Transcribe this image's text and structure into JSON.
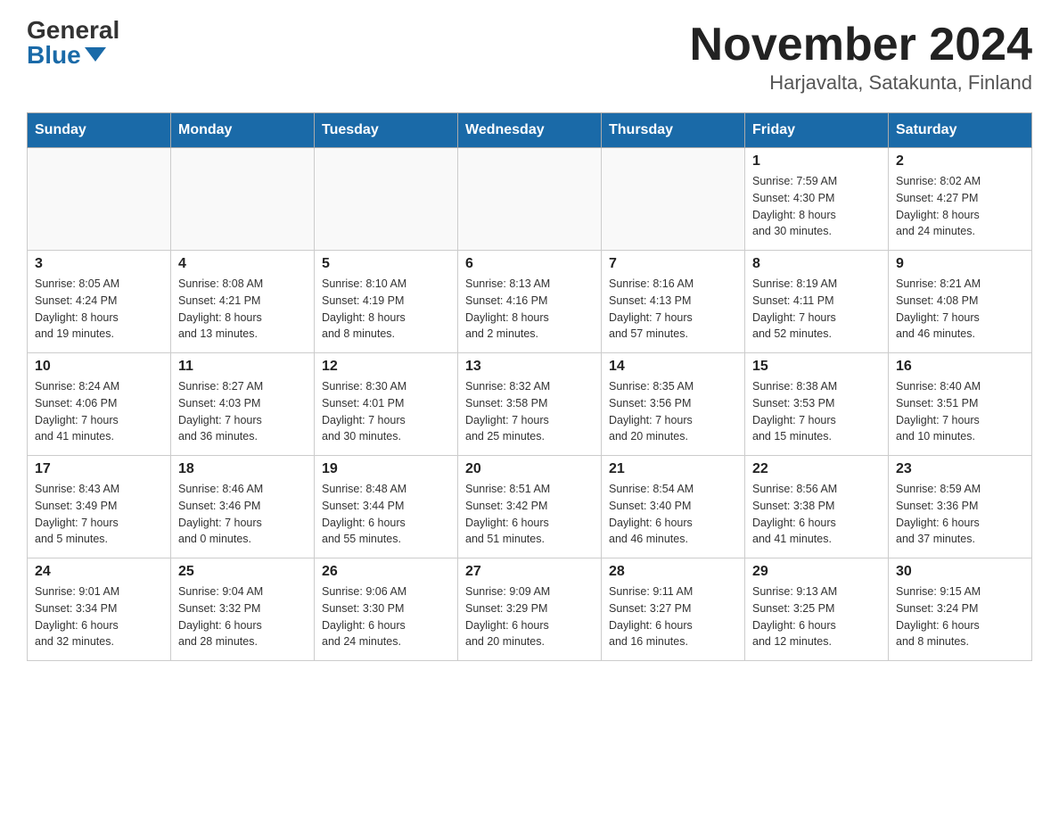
{
  "header": {
    "logo_general": "General",
    "logo_blue": "Blue",
    "month_title": "November 2024",
    "location": "Harjavalta, Satakunta, Finland"
  },
  "weekdays": [
    "Sunday",
    "Monday",
    "Tuesday",
    "Wednesday",
    "Thursday",
    "Friday",
    "Saturday"
  ],
  "weeks": [
    [
      {
        "day": "",
        "info": ""
      },
      {
        "day": "",
        "info": ""
      },
      {
        "day": "",
        "info": ""
      },
      {
        "day": "",
        "info": ""
      },
      {
        "day": "",
        "info": ""
      },
      {
        "day": "1",
        "info": "Sunrise: 7:59 AM\nSunset: 4:30 PM\nDaylight: 8 hours\nand 30 minutes."
      },
      {
        "day": "2",
        "info": "Sunrise: 8:02 AM\nSunset: 4:27 PM\nDaylight: 8 hours\nand 24 minutes."
      }
    ],
    [
      {
        "day": "3",
        "info": "Sunrise: 8:05 AM\nSunset: 4:24 PM\nDaylight: 8 hours\nand 19 minutes."
      },
      {
        "day": "4",
        "info": "Sunrise: 8:08 AM\nSunset: 4:21 PM\nDaylight: 8 hours\nand 13 minutes."
      },
      {
        "day": "5",
        "info": "Sunrise: 8:10 AM\nSunset: 4:19 PM\nDaylight: 8 hours\nand 8 minutes."
      },
      {
        "day": "6",
        "info": "Sunrise: 8:13 AM\nSunset: 4:16 PM\nDaylight: 8 hours\nand 2 minutes."
      },
      {
        "day": "7",
        "info": "Sunrise: 8:16 AM\nSunset: 4:13 PM\nDaylight: 7 hours\nand 57 minutes."
      },
      {
        "day": "8",
        "info": "Sunrise: 8:19 AM\nSunset: 4:11 PM\nDaylight: 7 hours\nand 52 minutes."
      },
      {
        "day": "9",
        "info": "Sunrise: 8:21 AM\nSunset: 4:08 PM\nDaylight: 7 hours\nand 46 minutes."
      }
    ],
    [
      {
        "day": "10",
        "info": "Sunrise: 8:24 AM\nSunset: 4:06 PM\nDaylight: 7 hours\nand 41 minutes."
      },
      {
        "day": "11",
        "info": "Sunrise: 8:27 AM\nSunset: 4:03 PM\nDaylight: 7 hours\nand 36 minutes."
      },
      {
        "day": "12",
        "info": "Sunrise: 8:30 AM\nSunset: 4:01 PM\nDaylight: 7 hours\nand 30 minutes."
      },
      {
        "day": "13",
        "info": "Sunrise: 8:32 AM\nSunset: 3:58 PM\nDaylight: 7 hours\nand 25 minutes."
      },
      {
        "day": "14",
        "info": "Sunrise: 8:35 AM\nSunset: 3:56 PM\nDaylight: 7 hours\nand 20 minutes."
      },
      {
        "day": "15",
        "info": "Sunrise: 8:38 AM\nSunset: 3:53 PM\nDaylight: 7 hours\nand 15 minutes."
      },
      {
        "day": "16",
        "info": "Sunrise: 8:40 AM\nSunset: 3:51 PM\nDaylight: 7 hours\nand 10 minutes."
      }
    ],
    [
      {
        "day": "17",
        "info": "Sunrise: 8:43 AM\nSunset: 3:49 PM\nDaylight: 7 hours\nand 5 minutes."
      },
      {
        "day": "18",
        "info": "Sunrise: 8:46 AM\nSunset: 3:46 PM\nDaylight: 7 hours\nand 0 minutes."
      },
      {
        "day": "19",
        "info": "Sunrise: 8:48 AM\nSunset: 3:44 PM\nDaylight: 6 hours\nand 55 minutes."
      },
      {
        "day": "20",
        "info": "Sunrise: 8:51 AM\nSunset: 3:42 PM\nDaylight: 6 hours\nand 51 minutes."
      },
      {
        "day": "21",
        "info": "Sunrise: 8:54 AM\nSunset: 3:40 PM\nDaylight: 6 hours\nand 46 minutes."
      },
      {
        "day": "22",
        "info": "Sunrise: 8:56 AM\nSunset: 3:38 PM\nDaylight: 6 hours\nand 41 minutes."
      },
      {
        "day": "23",
        "info": "Sunrise: 8:59 AM\nSunset: 3:36 PM\nDaylight: 6 hours\nand 37 minutes."
      }
    ],
    [
      {
        "day": "24",
        "info": "Sunrise: 9:01 AM\nSunset: 3:34 PM\nDaylight: 6 hours\nand 32 minutes."
      },
      {
        "day": "25",
        "info": "Sunrise: 9:04 AM\nSunset: 3:32 PM\nDaylight: 6 hours\nand 28 minutes."
      },
      {
        "day": "26",
        "info": "Sunrise: 9:06 AM\nSunset: 3:30 PM\nDaylight: 6 hours\nand 24 minutes."
      },
      {
        "day": "27",
        "info": "Sunrise: 9:09 AM\nSunset: 3:29 PM\nDaylight: 6 hours\nand 20 minutes."
      },
      {
        "day": "28",
        "info": "Sunrise: 9:11 AM\nSunset: 3:27 PM\nDaylight: 6 hours\nand 16 minutes."
      },
      {
        "day": "29",
        "info": "Sunrise: 9:13 AM\nSunset: 3:25 PM\nDaylight: 6 hours\nand 12 minutes."
      },
      {
        "day": "30",
        "info": "Sunrise: 9:15 AM\nSunset: 3:24 PM\nDaylight: 6 hours\nand 8 minutes."
      }
    ]
  ]
}
